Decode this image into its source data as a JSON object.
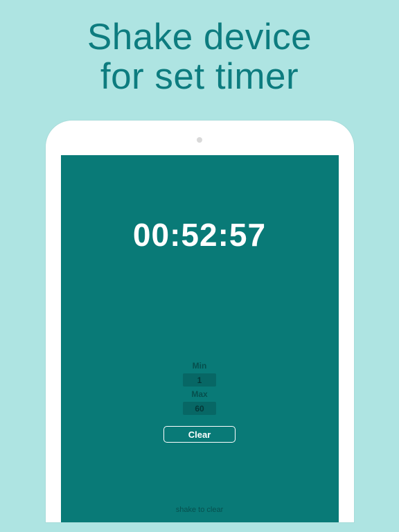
{
  "headline": {
    "line1": "Shake device",
    "line2": "for set timer"
  },
  "app": {
    "timer_display": "00:52:57",
    "min_label": "Min",
    "min_value": "1",
    "max_label": "Max",
    "max_value": "60",
    "clear_label": "Clear",
    "hint": "shake to clear"
  }
}
